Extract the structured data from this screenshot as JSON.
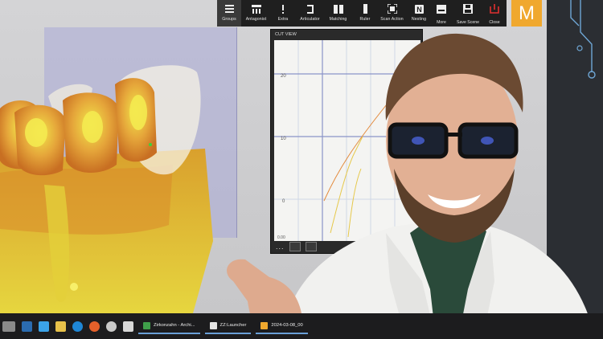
{
  "toolbar": {
    "items": [
      {
        "label": "Groups",
        "icon": "menu-icon",
        "active": true
      },
      {
        "label": "Antagonist",
        "icon": "antagonist-icon",
        "active": false
      },
      {
        "label": "Extra",
        "icon": "exclamation-icon",
        "active": false
      },
      {
        "label": "Articulator",
        "icon": "articulator-icon",
        "active": false
      },
      {
        "label": "Matching",
        "icon": "matching-icon",
        "active": false
      },
      {
        "label": "Ruler",
        "icon": "ruler-icon",
        "active": false
      },
      {
        "label": "Scan Action",
        "icon": "scan-action-icon",
        "active": false
      },
      {
        "label": "Nesting",
        "icon": "nesting-icon",
        "active": false
      }
    ],
    "right": [
      {
        "label": "More",
        "icon": "more-icon"
      },
      {
        "label": "Save Scene",
        "icon": "save-icon"
      },
      {
        "label": "Close",
        "icon": "close-icon"
      }
    ]
  },
  "logo": {
    "letter": "M",
    "color": "#f0a82e"
  },
  "cutview": {
    "title": "CUT VIEW",
    "y_ticks": [
      "20",
      "10",
      "0"
    ],
    "bottom_label": "0.00",
    "more": "..."
  },
  "taskbar": {
    "apps": [
      {
        "label": "Zirkonzahn - Archi...",
        "icon_color": "#3f9e4a"
      },
      {
        "label": "ZZ:Launcher",
        "icon_color": "#e4e4e4"
      },
      {
        "label": "2024-03-08_00",
        "icon_color": "#f0a82e"
      }
    ]
  },
  "colors": {
    "accent": "#f0a82e",
    "tooth_yellow": "#e9d84a",
    "tooth_orange": "#e08a2a",
    "slab": "#aaaad7"
  }
}
